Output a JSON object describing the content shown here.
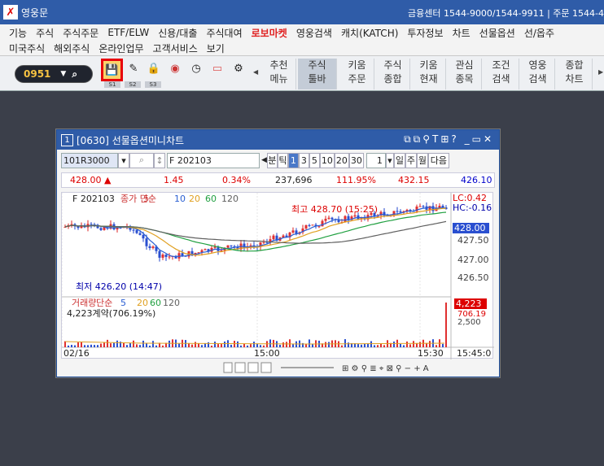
{
  "app": {
    "title": "영웅문",
    "status": "금융센터 1544-9000/1544-9911 | 주문 1544-4"
  },
  "menu": [
    "기능",
    "주식",
    "주식주문",
    "ETF/ELW",
    "신용/대출",
    "주식대여",
    "로보마켓",
    "영웅검색",
    "캐치(KATCH)",
    "투자정보",
    "차트",
    "선물옵션",
    "선/옵주"
  ],
  "menu_highlight": "로보마켓",
  "menu2": [
    "미국주식",
    "해외주식",
    "온라인업무",
    "고객서비스",
    "보기"
  ],
  "toolbar": {
    "code": "0951",
    "tabs": [
      "S1",
      "S2",
      "S3"
    ],
    "buttons": [
      {
        "l1": "추천",
        "l2": "메뉴"
      },
      {
        "l1": "주식",
        "l2": "툴바"
      },
      {
        "l1": "키움",
        "l2": "주문"
      },
      {
        "l1": "주식",
        "l2": "종합"
      },
      {
        "l1": "키움",
        "l2": "현재"
      },
      {
        "l1": "관심",
        "l2": "종목"
      },
      {
        "l1": "조건",
        "l2": "검색"
      },
      {
        "l1": "영웅",
        "l2": "검색"
      },
      {
        "l1": "종합",
        "l2": "차트"
      }
    ],
    "icons": [
      "save-icon",
      "brush-icon",
      "lock-icon",
      "camera-icon",
      "clock-icon",
      "monitor-icon",
      "gear-icon"
    ]
  },
  "window": {
    "num": "1",
    "title": "[0630] 선물옵션미니차트",
    "code": "101R3000",
    "name": "F 202103",
    "timeframes": [
      "분",
      "틱",
      "1",
      "3",
      "5",
      "10",
      "20",
      "30"
    ],
    "active_tf": "1",
    "period": "1",
    "units": [
      "일",
      "주",
      "월"
    ],
    "next": "다음",
    "quote": {
      "price": "428.00",
      "arrow": "▲",
      "change": "1.45",
      "pct": "0.34%",
      "volume": "237,696",
      "ratio": "111.95%",
      "high": "432.15",
      "last": "426.10"
    }
  },
  "chart_data": {
    "type": "candlestick",
    "legend": [
      "F 202103",
      "종가 단순",
      "5",
      "10",
      "20",
      "60",
      "120"
    ],
    "annotations": {
      "high": "최고 428.70 (15:25)",
      "low": "최저 426.20 (14:47)",
      "lc": "LC:0.42",
      "hc": "HC:-0.16"
    },
    "y_ticks": [
      "427.50",
      "427.00",
      "426.50"
    ],
    "price_label": "428.00",
    "volume_legend": [
      "거래량",
      "단순",
      "5",
      "20",
      "60",
      "120"
    ],
    "volume_info": "4,223계약(706.19%)",
    "volume_labels": [
      "4,223",
      "706.19",
      "2,500"
    ],
    "x_ticks": [
      "02/16",
      "15:00",
      "15:30",
      "15:45:0"
    ],
    "ma_colors": [
      "#2a5fd2",
      "#e0a020",
      "#20a040",
      "#606060"
    ]
  }
}
